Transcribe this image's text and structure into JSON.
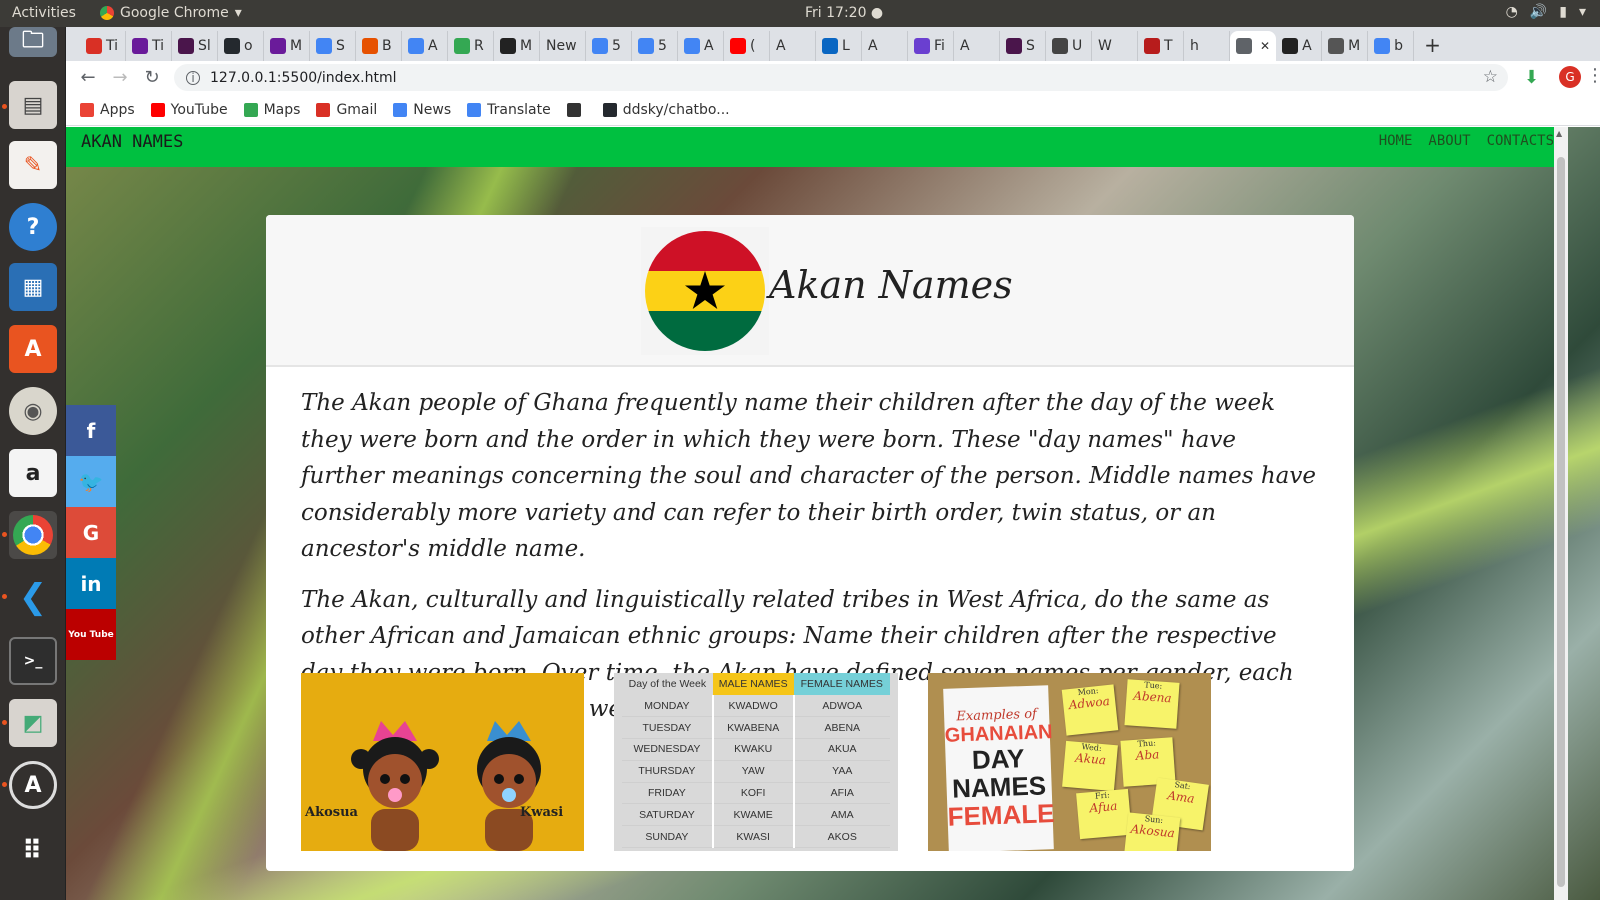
{
  "os": {
    "activities": "Activities",
    "app_name": "Google Chrome",
    "clock": "Fri 17:20"
  },
  "tabs": [
    {
      "label": "Ti",
      "color": "#d93025",
      "icon": "gmail-icon"
    },
    {
      "label": "Ti",
      "color": "#6a1b9a",
      "icon": "list-icon"
    },
    {
      "label": "Sl",
      "color": "#4a154b",
      "icon": "slack-icon"
    },
    {
      "label": "o",
      "color": "#24292e",
      "icon": "github-icon"
    },
    {
      "label": "M",
      "color": "#6a1b9a",
      "icon": "list-icon"
    },
    {
      "label": "S",
      "color": "#4285f4",
      "icon": "google-icon"
    },
    {
      "label": "B",
      "color": "#e65100",
      "icon": "b-icon"
    },
    {
      "label": "A",
      "color": "#4285f4",
      "icon": "google-icon"
    },
    {
      "label": "R",
      "color": "#34a853",
      "icon": "r-icon"
    },
    {
      "label": "M",
      "color": "#222",
      "icon": "is-icon"
    },
    {
      "label": "New",
      "color": "",
      "icon": ""
    },
    {
      "label": "5",
      "color": "#4285f4",
      "icon": "google-icon"
    },
    {
      "label": "5",
      "color": "#4285f4",
      "icon": "google-icon"
    },
    {
      "label": "A",
      "color": "#4285f4",
      "icon": "google-icon"
    },
    {
      "label": "(",
      "color": "#ff0000",
      "icon": "youtube-icon"
    },
    {
      "label": "A",
      "color": "",
      "icon": ""
    },
    {
      "label": "L",
      "color": "#0a66c2",
      "icon": "linkedin-icon"
    },
    {
      "label": "A",
      "color": "",
      "icon": ""
    },
    {
      "label": "Fi",
      "color": "#6a3fd0",
      "icon": "facebook-icon"
    },
    {
      "label": "A",
      "color": "",
      "icon": ""
    },
    {
      "label": "S",
      "color": "#4a154b",
      "icon": "slack-icon"
    },
    {
      "label": "U",
      "color": "#444",
      "icon": "u-icon"
    },
    {
      "label": "W",
      "color": "",
      "icon": ""
    },
    {
      "label": "T",
      "color": "#b71c1c",
      "icon": "t-icon"
    },
    {
      "label": "h",
      "color": "",
      "icon": ""
    },
    {
      "label": "",
      "color": "#5f6368",
      "icon": "globe-icon",
      "active": true,
      "close": "✕"
    },
    {
      "label": "A",
      "color": "#222",
      "icon": "wikipedia-icon"
    },
    {
      "label": "M",
      "color": "#555",
      "icon": "m-icon"
    },
    {
      "label": "b",
      "color": "#4285f4",
      "icon": "google-icon"
    }
  ],
  "new_tab": "+",
  "address": "127.0.0.1:5500/index.html",
  "bookmarks": [
    {
      "label": "Apps",
      "icon": "apps-icon",
      "color": "#ea4335"
    },
    {
      "label": "YouTube",
      "icon": "youtube-icon",
      "color": "#ff0000"
    },
    {
      "label": "Maps",
      "icon": "maps-icon",
      "color": "#34a853"
    },
    {
      "label": "Gmail",
      "icon": "gmail-icon",
      "color": "#d93025"
    },
    {
      "label": "News",
      "icon": "news-icon",
      "color": "#4285f4"
    },
    {
      "label": "Translate",
      "icon": "translate-icon",
      "color": "#4285f4"
    },
    {
      "label": "",
      "icon": "globe-icon",
      "color": "#333"
    },
    {
      "label": "ddsky/chatbo...",
      "icon": "github-icon",
      "color": "#24292e"
    }
  ],
  "site": {
    "brand": "AKAN NAMES",
    "nav": [
      "HOME",
      "ABOUT",
      "CONTACTS"
    ],
    "title": "Akan Names",
    "paragraphs": [
      "The Akan people of Ghana frequently name their children after the day of the week they were born and the order in which they were born. These \"day names\" have further meanings concerning the soul and character of the person. Middle names have considerably more variety and can refer to their birth order, twin status, or an ancestor's middle name.",
      "The Akan, culturally and linguistically related tribes in West Africa, do the same as other African and Jamaican ethnic groups: Name their children after the respective day they were born. Over time, the Akan have defined seven names per gender, each referring to a day of the week."
    ],
    "social": [
      {
        "glyph": "f",
        "icon": "facebook-icon",
        "color": "#3b5998"
      },
      {
        "glyph": "🐦",
        "icon": "twitter-icon",
        "color": "#55acee"
      },
      {
        "glyph": "G",
        "icon": "google-plus-icon",
        "color": "#dd4b39"
      },
      {
        "glyph": "in",
        "icon": "linkedin-icon",
        "color": "#007bb5"
      },
      {
        "glyph": "You Tube",
        "icon": "youtube-icon",
        "color": "#bb0000"
      }
    ],
    "image1": {
      "left_name": "Akosua",
      "right_name": "Kwasi"
    },
    "day_table": {
      "headers": [
        "Day of the Week",
        "MALE NAMES",
        "FEMALE NAMES"
      ],
      "rows": [
        [
          "MONDAY",
          "KWADWO",
          "ADWOA"
        ],
        [
          "TUESDAY",
          "KWABENA",
          "ABENA"
        ],
        [
          "WEDNESDAY",
          "KWAKU",
          "AKUA"
        ],
        [
          "THURSDAY",
          "YAW",
          "YAA"
        ],
        [
          "FRIDAY",
          "KOFI",
          "AFIA"
        ],
        [
          "SATURDAY",
          "KWAME",
          "AMA"
        ],
        [
          "SUNDAY",
          "KWASI",
          "AKOS"
        ]
      ]
    },
    "image3": {
      "examples": "Examples of",
      "line1": "GHANAIAN",
      "line2": "DAY",
      "line3": "NAMES",
      "line4": "FEMALE",
      "notes": [
        {
          "day": "Mon:",
          "name": "Adwoa"
        },
        {
          "day": "Tue:",
          "name": "Abena"
        },
        {
          "day": "Wed:",
          "name": "Akua"
        },
        {
          "day": "Thu:",
          "name": "Aba"
        },
        {
          "day": "Sat:",
          "name": "Ama"
        },
        {
          "day": "Fri:",
          "name": "Afua"
        },
        {
          "day": "Sun:",
          "name": "Akosua"
        }
      ]
    }
  }
}
